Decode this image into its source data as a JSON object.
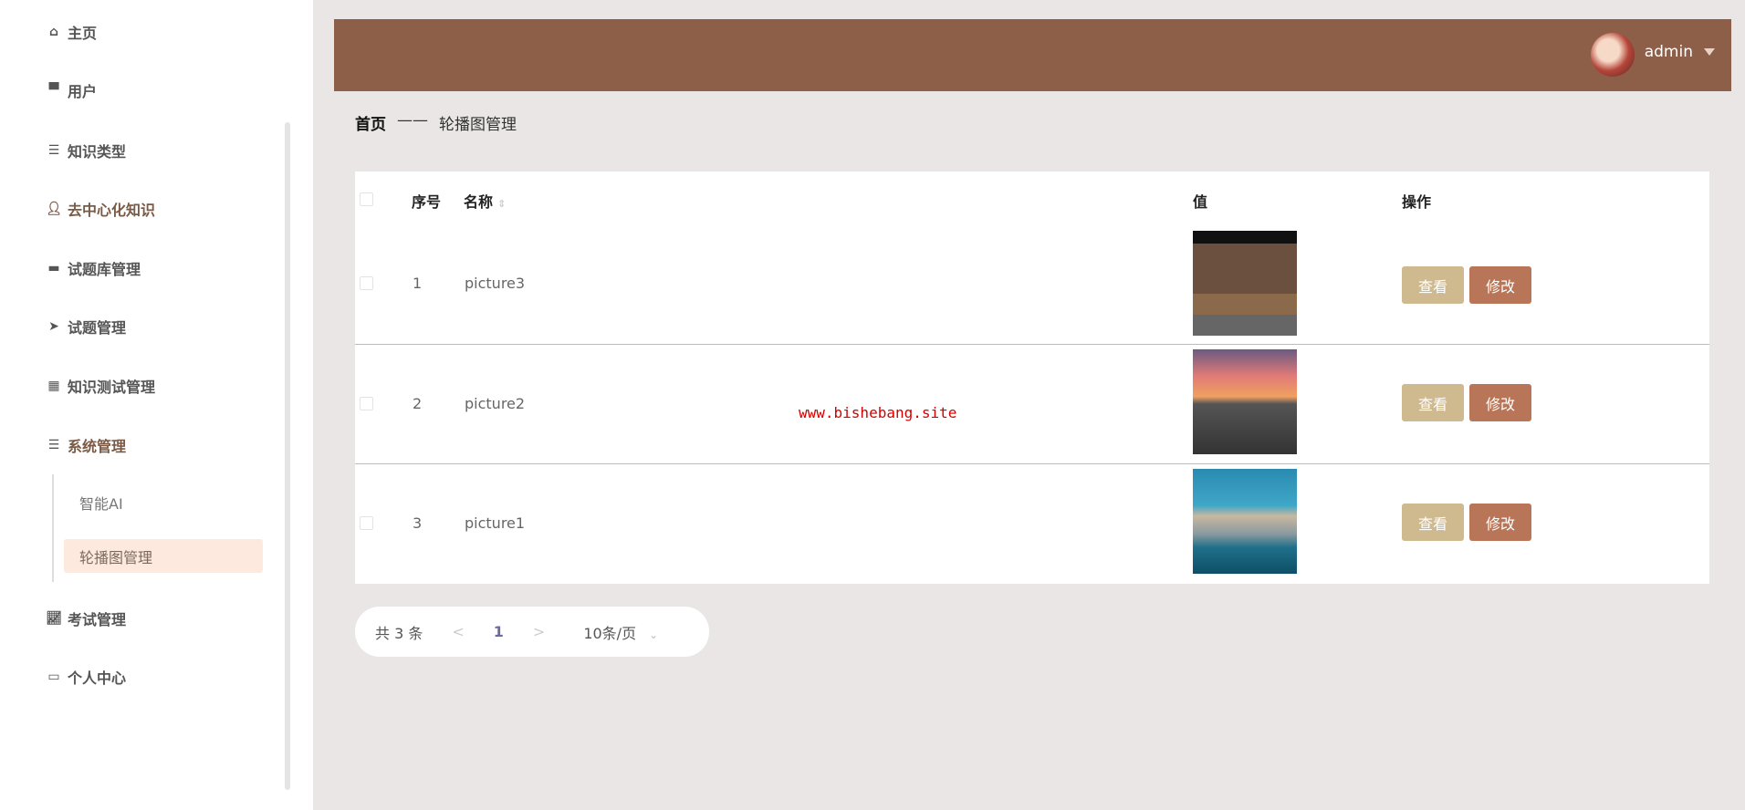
{
  "sidebar": {
    "items": [
      {
        "label": "主页",
        "icon": "home-icon"
      },
      {
        "label": "用户",
        "icon": "user-card-icon"
      },
      {
        "label": "知识类型",
        "icon": "list-icon"
      },
      {
        "label": "去中心化知识",
        "icon": "person-icon"
      },
      {
        "label": "试题库管理",
        "icon": "monitor-icon"
      },
      {
        "label": "试题管理",
        "icon": "send-icon"
      },
      {
        "label": "知识测试管理",
        "icon": "grid-icon"
      },
      {
        "label": "系统管理",
        "icon": "menu-icon"
      },
      {
        "label": "考试管理",
        "icon": "chart-icon"
      },
      {
        "label": "个人中心",
        "icon": "wallet-icon"
      }
    ],
    "submenu": [
      {
        "label": "智能AI"
      },
      {
        "label": "轮播图管理",
        "active": true
      }
    ]
  },
  "header": {
    "username": "admin"
  },
  "breadcrumb": {
    "home": "首页",
    "sep": "——",
    "current": "轮播图管理"
  },
  "table": {
    "headers": {
      "index": "序号",
      "name": "名称",
      "value": "值",
      "actions": "操作"
    },
    "rows": [
      {
        "index": "1",
        "name": "picture3"
      },
      {
        "index": "2",
        "name": "picture2"
      },
      {
        "index": "3",
        "name": "picture1"
      }
    ],
    "view_label": "查看",
    "edit_label": "修改"
  },
  "watermark": "www.bishebang.site",
  "pagination": {
    "total": "共 3 条",
    "prev": "<",
    "page": "1",
    "next": ">",
    "page_size": "10条/页",
    "caret": "⌄"
  },
  "colors": {
    "header": "#8d5f49",
    "view": "#cfb98f",
    "edit": "#b87558"
  }
}
